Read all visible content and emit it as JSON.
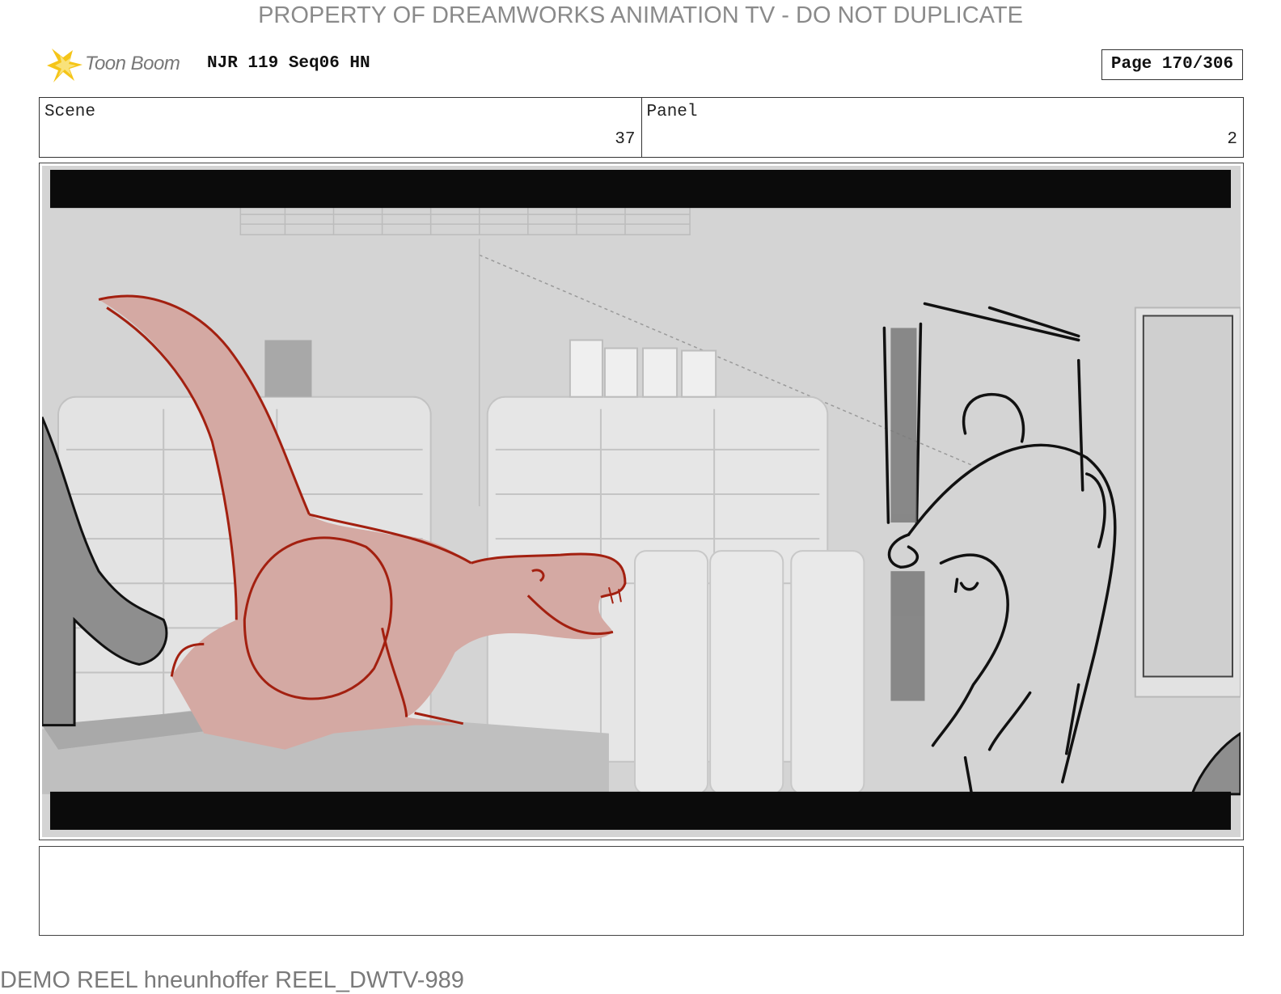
{
  "header": {
    "watermark": "PROPERTY OF DREAMWORKS ANIMATION TV - DO NOT DUPLICATE",
    "logo_text": "Toon Boom",
    "doc_title": "NJR 119 Seq06 HN",
    "page_label": "Page 170/306"
  },
  "info": {
    "scene_label": "Scene",
    "scene_value": "37",
    "panel_label": "Panel",
    "panel_value": "2"
  },
  "notes": {
    "text": ""
  },
  "footer": {
    "text": "DEMO REEL hneunhoffer REEL_DWTV-989"
  },
  "colors": {
    "dino_fill": "#d4a9a3",
    "dino_line": "#a32010",
    "letterbox": "#0b0b0b",
    "background": "#d6d6d6"
  }
}
